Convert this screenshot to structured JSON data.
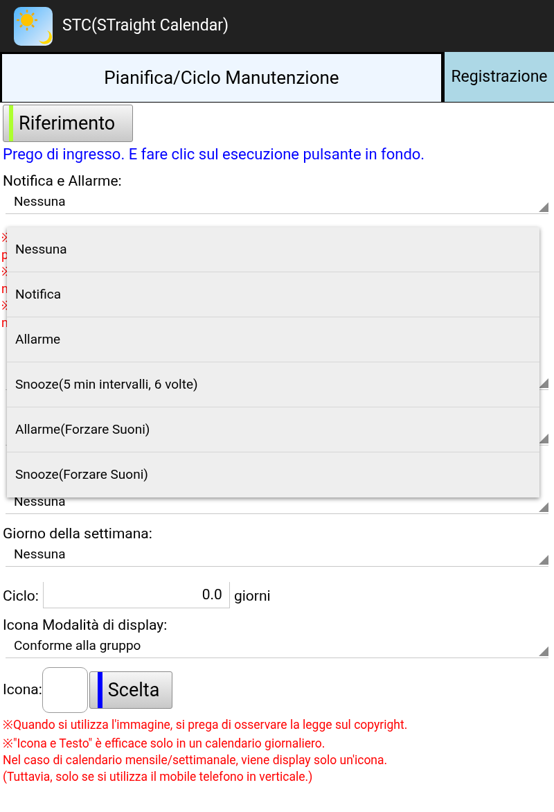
{
  "app_bar": {
    "title": "STC(STraight Calendar)"
  },
  "tabs": [
    {
      "label": "Pianifica/Ciclo Manutenzione",
      "selected": true
    },
    {
      "label": "Registrazione",
      "selected": false
    }
  ],
  "reference_button": {
    "label": "Riferimento"
  },
  "instruction": "Prego di ingresso. E fare clic sul esecuzione pulsante in fondo.",
  "notification": {
    "label": "Notifica e Allarme:",
    "value": "Nessuna"
  },
  "hidden_notes": [
    "※",
    "p",
    "※",
    "n",
    "※",
    "n"
  ],
  "hidden_fields": [
    {
      "value": "Nessuna"
    }
  ],
  "weekday": {
    "label": "Giorno della settimana:",
    "value": "Nessuna"
  },
  "cycle": {
    "label": "Ciclo:",
    "value": "0.0",
    "unit": "giorni"
  },
  "icon_mode": {
    "label": "Icona Modalità di display:",
    "value": "Conforme alla gruppo"
  },
  "icon": {
    "label": "Icona:",
    "button": "Scelta"
  },
  "notes": [
    "※Quando si utilizza l'immagine, si prega di osservare la legge sul copyright.",
    "※\"Icona e Testo\" è efficace solo in un calendario giornaliero.",
    "Nel caso di calendario mensile/settimanale, viene display solo un'icona.",
    "(Tuttavia, solo se si utilizza il mobile telefono in verticale.)"
  ],
  "dropdown": {
    "options": [
      "Nessuna",
      "Notifica",
      "Allarme",
      "Snooze(5 min intervalli, 6 volte)",
      "Allarme(Forzare Suoni)",
      "Snooze(Forzare Suoni)"
    ]
  }
}
